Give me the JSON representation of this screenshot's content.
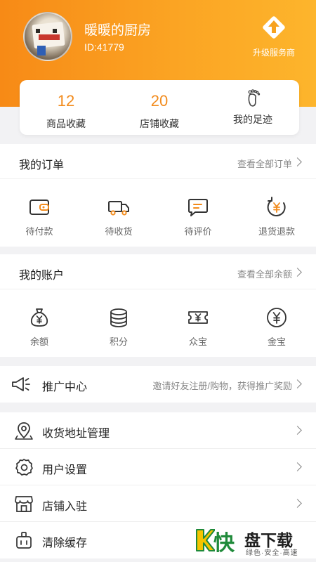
{
  "profile": {
    "name": "暖暖的厨房",
    "id_text": "ID:41779",
    "upgrade_label": "升级服务商"
  },
  "stats": [
    {
      "value": "12",
      "label": "商品收藏"
    },
    {
      "value": "20",
      "label": "店铺收藏"
    },
    {
      "label": "我的足迹",
      "icon": "footprint-icon"
    }
  ],
  "orders": {
    "title": "我的订单",
    "more": "查看全部订单",
    "items": [
      {
        "label": "待付款",
        "icon": "wallet-icon"
      },
      {
        "label": "待收货",
        "icon": "truck-icon"
      },
      {
        "label": "待评价",
        "icon": "comment-icon"
      },
      {
        "label": "退货退款",
        "icon": "refund-icon"
      }
    ]
  },
  "account": {
    "title": "我的账户",
    "more": "查看全部余额",
    "items": [
      {
        "label": "余额",
        "icon": "money-bag-icon"
      },
      {
        "label": "积分",
        "icon": "coins-icon"
      },
      {
        "label": "众宝",
        "icon": "ticket-icon"
      },
      {
        "label": "金宝",
        "icon": "yuan-coin-icon"
      }
    ]
  },
  "promo": {
    "label": "推广中心",
    "hint": "邀请好友注册/购物，获得推广奖励",
    "icon": "megaphone-icon"
  },
  "menu": [
    {
      "label": "收货地址管理",
      "icon": "location-icon"
    },
    {
      "label": "用户设置",
      "icon": "settings-icon"
    },
    {
      "label": "店铺入驻",
      "icon": "store-icon"
    },
    {
      "label": "清除缓存",
      "icon": "clear-cache-icon"
    }
  ],
  "watermark": {
    "brand_big": "快",
    "brand_rest": "盘下载",
    "tagline": "绿色·安全·高速"
  },
  "colors": {
    "header_start": "#f78a16",
    "header_end": "#fdb52c",
    "accent": "#f28b1c"
  }
}
